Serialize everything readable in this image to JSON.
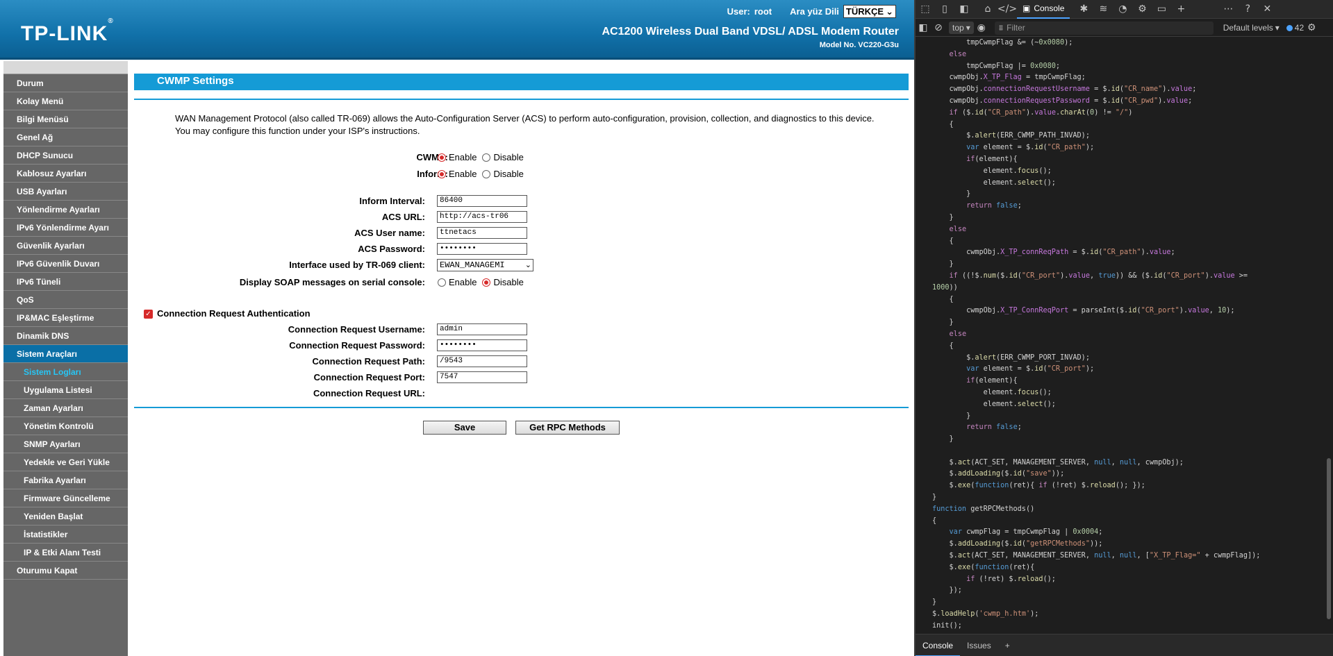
{
  "header": {
    "logo": "TP-LINK",
    "logo_mark": "®",
    "user_label": "User:",
    "user_value": "root",
    "lang_label": "Ara yüz Dili",
    "lang_value": "TÜRKÇE",
    "product": "AC1200 Wireless Dual Band VDSL/ ADSL Modem Router",
    "model": "Model No. VC220-G3u"
  },
  "sidebar": {
    "items": [
      {
        "label": "Durum"
      },
      {
        "label": "Kolay Menü"
      },
      {
        "label": "Bilgi Menüsü"
      },
      {
        "label": "Genel Ağ"
      },
      {
        "label": "DHCP Sunucu"
      },
      {
        "label": "Kablosuz Ayarları"
      },
      {
        "label": "USB Ayarları"
      },
      {
        "label": "Yönlendirme Ayarları"
      },
      {
        "label": "IPv6 Yönlendirme Ayarı"
      },
      {
        "label": "Güvenlik Ayarları"
      },
      {
        "label": "IPv6 Güvenlik Duvarı"
      },
      {
        "label": "IPv6 Tüneli"
      },
      {
        "label": "QoS"
      },
      {
        "label": "IP&MAC Eşleştirme"
      },
      {
        "label": "Dinamik DNS"
      },
      {
        "label": "Sistem Araçları"
      },
      {
        "label": "Sistem Logları"
      },
      {
        "label": "Uygulama Listesi"
      },
      {
        "label": "Zaman Ayarları"
      },
      {
        "label": "Yönetim Kontrolü"
      },
      {
        "label": "SNMP Ayarları"
      },
      {
        "label": "Yedekle ve Geri Yükle"
      },
      {
        "label": "Fabrika Ayarları"
      },
      {
        "label": "Firmware Güncelleme"
      },
      {
        "label": "Yeniden Başlat"
      },
      {
        "label": "İstatistikler"
      },
      {
        "label": "IP & Etki Alanı Testi"
      },
      {
        "label": "Oturumu Kapat"
      }
    ]
  },
  "page": {
    "title": "CWMP Settings",
    "desc": "WAN Management Protocol (also called TR-069) allows the Auto-Configuration Server (ACS) to perform auto-configuration, provision, collection, and diagnostics to this device. You may configure this function under your ISP's instructions.",
    "enable_label": "Enable",
    "disable_label": "Disable",
    "cwmp_label": "CWMP:",
    "inform_label": "Inform:",
    "inform_interval_label": "Inform Interval:",
    "inform_interval_value": "86400",
    "acs_url_label": "ACS URL:",
    "acs_url_value": "http://acs-tr06",
    "acs_user_label": "ACS User name:",
    "acs_user_value": "ttnetacs",
    "acs_pwd_label": "ACS Password:",
    "acs_pwd_value": "••••••••",
    "iface_label": "Interface used by TR-069 client:",
    "iface_value": "EWAN_MANAGEMI",
    "soap_label": "Display SOAP messages on serial console:",
    "cra_label": "Connection Request Authentication",
    "cr_user_label": "Connection Request Username:",
    "cr_user_value": "admin",
    "cr_pwd_label": "Connection Request Password:",
    "cr_pwd_value": "••••••••",
    "cr_path_label": "Connection Request Path:",
    "cr_path_value": "/9543",
    "cr_port_label": "Connection Request Port:",
    "cr_port_value": "7547",
    "cr_url_label": "Connection Request URL:",
    "save_label": "Save",
    "rpc_label": "Get RPC Methods"
  },
  "devtools": {
    "console_tab": "Console",
    "context": "top",
    "filter_placeholder": "Filter",
    "levels": "Default levels",
    "issues_count": "42",
    "bottom_console": "Console",
    "bottom_issues": "Issues",
    "code_lines": [
      "        tmpCwmpFlag &= (~0x0080);",
      "    else",
      "        tmpCwmpFlag |= 0x0080;",
      "    cwmpObj.X_TP_Flag = tmpCwmpFlag;",
      "    cwmpObj.connectionRequestUsername = $.id(\"CR_name\").value;",
      "    cwmpObj.connectionRequestPassword = $.id(\"CR_pwd\").value;",
      "    if ($.id(\"CR_path\").value.charAt(0) != \"/\")",
      "    {",
      "        $.alert(ERR_CWMP_PATH_INVAD);",
      "        var element = $.id(\"CR_path\");",
      "        if(element){",
      "            element.focus();",
      "            element.select();",
      "        }",
      "        return false;",
      "    }",
      "    else",
      "    {",
      "        cwmpObj.X_TP_connReqPath = $.id(\"CR_path\").value;",
      "    }",
      "    if ((!$.num($.id(\"CR_port\").value, true)) && ($.id(\"CR_port\").value >=",
      "1000))",
      "    {",
      "        cwmpObj.X_TP_ConnReqPort = parseInt($.id(\"CR_port\").value, 10);",
      "    }",
      "    else",
      "    {",
      "        $.alert(ERR_CWMP_PORT_INVAD);",
      "        var element = $.id(\"CR_port\");",
      "        if(element){",
      "            element.focus();",
      "            element.select();",
      "        }",
      "        return false;",
      "    }",
      "",
      "    $.act(ACT_SET, MANAGEMENT_SERVER, null, null, cwmpObj);",
      "    $.addLoading($.id(\"save\"));",
      "    $.exe(function(ret){ if (!ret) $.reload(); });",
      "}",
      "function getRPCMethods()",
      "{",
      "    var cwmpFlag = tmpCwmpFlag | 0x0004;",
      "    $.addLoading($.id(\"getRPCMethods\"));",
      "    $.act(ACT_SET, MANAGEMENT_SERVER, null, null, [\"X_TP_Flag=\" + cwmpFlag]);",
      "    $.exe(function(ret){",
      "        if (!ret) $.reload();",
      "    });",
      "}",
      "$.loadHelp('cwmp_h.htm');",
      "init();"
    ]
  }
}
